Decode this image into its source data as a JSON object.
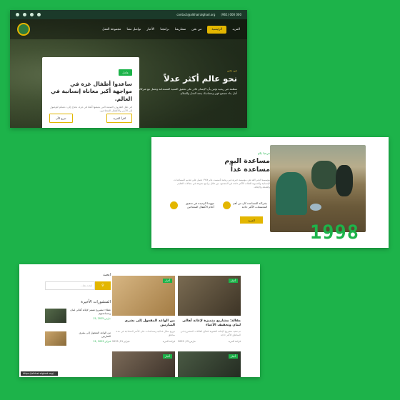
{
  "hero_panel": {
    "topbar": {
      "email": "contact@alkhairalghad.org",
      "phone": "(961) 000 000"
    },
    "nav": {
      "items": [
        "المزيد",
        "الرئيسية",
        "من نحن",
        "مشاريعنا",
        "برامجنا",
        "الأخبار",
        "تواصل معنا",
        "مجموعة العمل"
      ],
      "active_index": 1
    },
    "hero": {
      "tag": "من نحن",
      "title": "نحو عالم أكثر عدلاً",
      "text": "منظمة غير ربحية تؤمن بأن الإنسان قادر على تحقيق التنمية المستدامة وتعمل مع شركائها من أجل بناء مجتمع قوي ومتماسك يعمه العدل والسلام."
    },
    "card": {
      "badge": "عاجل",
      "title": "ساعدوا أطفال غزة في مواجهة أكبر معاناة إنسانية في العالم.",
      "text": "في ظل الظروف الصعبة التي يعيشها أهلنا في غزة، نحتاج إلى دعمكم للوصول إلى الأسر والأطفال المحتاجين.",
      "btn_more": "اقرأ المزيد",
      "btn_donate": "تبرع الآن"
    }
  },
  "about_panel": {
    "tag": "مرحبا بكم",
    "title_line1": "مساعدة اليوم",
    "title_line2": "مساعدة غداً",
    "text": "مؤسسة الخير الغد هي مؤسسة خيرية غير ربحية تأسست عام ١٩٩٨ تعمل على تقديم المساعدات الإنسانية والتنموية للفئات الأكثر حاجة في المجتمع، من خلال برامج متنوعة في مجالات التعليم والصحة والإغاثة.",
    "feature1": "بشراكة المساعدة كان من أهم المجتمعات الأكثر حاجة",
    "feature2": "جهودنا الوحيدة في تحقيق أحلام الأطفال المحتاجين",
    "more_btn": "المزيد",
    "year": "1998"
  },
  "blog_panel": {
    "search_label": "ابحث",
    "search_placeholder": "ابحث هنا...",
    "recent_title": "المنشورات الأخيرة",
    "recent_posts": [
      {
        "title": "غطاء: مشروع متميز لإغاثة أهالي لبنان ومساعدتهم",
        "date": "مارس 2025 ,15"
      },
      {
        "title": "من الواعد المفعول إلى بشرى الضاربين",
        "date": "فبراير 2025 ,21"
      }
    ],
    "posts": [
      {
        "badge": "أخبار",
        "title": "مقالة: مشاريع متميزة لإغاثة أهالي لبنان وتحفيف الأعباء",
        "excerpt": "تم تنفيذ مشروع الإغاثة الشتوية لصالح العائلات المتضررة في المناطق الأكثر حاجة",
        "date": "مارس 15, 2025",
        "more": "قراءة المزيد"
      },
      {
        "badge": "أخبار",
        "title": "من الواعد المفعول إلى بشرى الضاربين",
        "excerpt": "توزيع سلال غذائية ومساعدات على الأسر المحتاجة في عدة مناطق",
        "date": "فبراير 21, 2025",
        "more": "قراءة المزيد"
      }
    ],
    "status_url": "https://alkhairalghad.org/..."
  }
}
